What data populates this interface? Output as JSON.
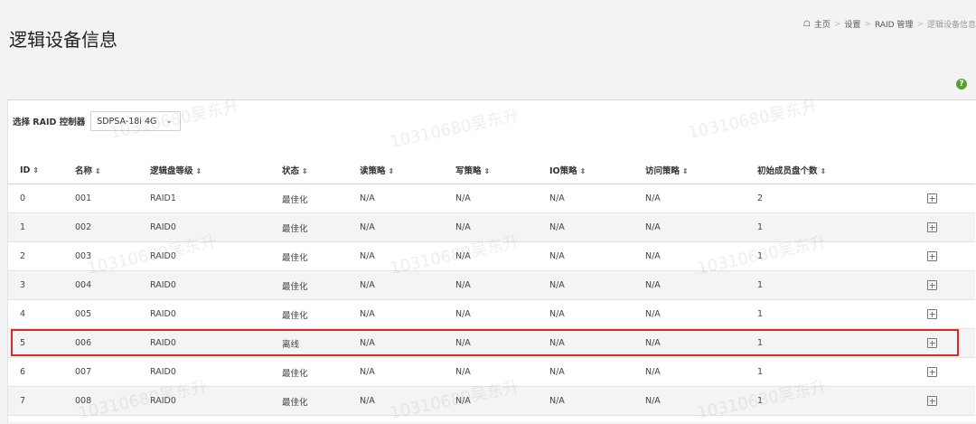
{
  "page": {
    "title": "逻辑设备信息",
    "breadcrumb": [
      "主页",
      "设置",
      "RAID 管理",
      "逻辑设备信息"
    ]
  },
  "controller": {
    "label": "选择 RAID 控制器",
    "selected": "SDPSA-18i 4G"
  },
  "table": {
    "columns": [
      "ID",
      "名称",
      "逻辑盘等级",
      "状态",
      "读策略",
      "写策略",
      "IO策略",
      "访问策略",
      "初始成员盘个数"
    ],
    "rows": [
      [
        "0",
        "001",
        "RAID1",
        "最佳化",
        "N/A",
        "N/A",
        "N/A",
        "N/A",
        "2"
      ],
      [
        "1",
        "002",
        "RAID0",
        "最佳化",
        "N/A",
        "N/A",
        "N/A",
        "N/A",
        "1"
      ],
      [
        "2",
        "003",
        "RAID0",
        "最佳化",
        "N/A",
        "N/A",
        "N/A",
        "N/A",
        "1"
      ],
      [
        "3",
        "004",
        "RAID0",
        "最佳化",
        "N/A",
        "N/A",
        "N/A",
        "N/A",
        "1"
      ],
      [
        "4",
        "005",
        "RAID0",
        "最佳化",
        "N/A",
        "N/A",
        "N/A",
        "N/A",
        "1"
      ],
      [
        "5",
        "006",
        "RAID0",
        "离线",
        "N/A",
        "N/A",
        "N/A",
        "N/A",
        "1"
      ],
      [
        "6",
        "007",
        "RAID0",
        "最佳化",
        "N/A",
        "N/A",
        "N/A",
        "N/A",
        "1"
      ],
      [
        "7",
        "008",
        "RAID0",
        "最佳化",
        "N/A",
        "N/A",
        "N/A",
        "N/A",
        "1"
      ]
    ],
    "highlighted_row": 5
  },
  "colors": {
    "highlight_border": "#d42a2a",
    "help_icon": "#5aa02c"
  },
  "watermark": "10310680吴东升"
}
